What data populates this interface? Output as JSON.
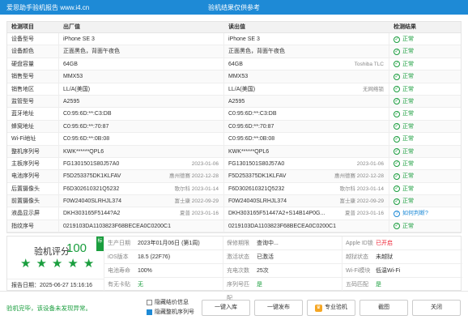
{
  "window": {
    "title": "爱思助手验机报告 www.i4.cn",
    "center_note": "验机结果仅供参考"
  },
  "table": {
    "headers": [
      "检测项目",
      "出厂值",
      "读出值",
      "检测结果"
    ],
    "rows": [
      {
        "item": "设备型号",
        "factory": "iPhone SE 3",
        "factory_aux": "",
        "read": "iPhone SE 3",
        "read_aux": "",
        "result": "正常",
        "result_type": "ok"
      },
      {
        "item": "设备颜色",
        "factory": "正面黑色，背面午夜色",
        "factory_aux": "",
        "read": "正面黑色，背面午夜色",
        "read_aux": "",
        "result": "正常",
        "result_type": "ok"
      },
      {
        "item": "硬盘容量",
        "factory": "64GB",
        "factory_aux": "",
        "read": "64GB",
        "read_aux": "Toshiba TLC",
        "result": "正常",
        "result_type": "ok"
      },
      {
        "item": "销售型号",
        "factory": "MMX53",
        "factory_aux": "",
        "read": "MMX53",
        "read_aux": "",
        "result": "正常",
        "result_type": "ok"
      },
      {
        "item": "销售地区",
        "factory": "LL/A(美国)",
        "factory_aux": "",
        "read": "LL/A(美国)",
        "read_aux": "无网络锁",
        "result": "正常",
        "result_type": "ok"
      },
      {
        "item": "监管型号",
        "factory": "A2595",
        "factory_aux": "",
        "read": "A2595",
        "read_aux": "",
        "result": "正常",
        "result_type": "ok"
      },
      {
        "item": "蓝牙地址",
        "factory": "C0:95:6D:**:C3:DB",
        "factory_aux": "",
        "read": "C0:95:6D:**:C3:DB",
        "read_aux": "",
        "result": "正常",
        "result_type": "ok"
      },
      {
        "item": "蜂窝地址",
        "factory": "C0:95:6D:**:70:87",
        "factory_aux": "",
        "read": "C0:95:6D:**:70:87",
        "read_aux": "",
        "result": "正常",
        "result_type": "ok"
      },
      {
        "item": "Wi-Fi地址",
        "factory": "C0:95:6D:**:0B:08",
        "factory_aux": "",
        "read": "C0:95:6D:**:0B:08",
        "read_aux": "",
        "result": "正常",
        "result_type": "ok"
      },
      {
        "item": "整机序列号",
        "factory": "KWK******QPL6",
        "factory_aux": "",
        "read": "KWK******QPL6",
        "read_aux": "",
        "result": "正常",
        "result_type": "ok"
      },
      {
        "item": "主板序列号",
        "factory": "FG1301501S80J57A0",
        "factory_aux": "2023-01-06",
        "read": "FG1301501S80J57A0",
        "read_aux": "2023-01-06",
        "result": "正常",
        "result_type": "ok"
      },
      {
        "item": "电池序列号",
        "factory": "F5D253375DK1KLFAV",
        "factory_aux": "惠州德赛 2022-12-28",
        "read": "F5D253375DK1KLFAV",
        "read_aux": "惠州德赛 2022-12-28",
        "result": "正常",
        "result_type": "ok"
      },
      {
        "item": "后置摄像头",
        "factory": "F6D302610321Q5232",
        "factory_aux": "歌尔科 2023-01-14",
        "read": "F6D302610321Q5232",
        "read_aux": "歌尔科 2023-01-14",
        "result": "正常",
        "result_type": "ok"
      },
      {
        "item": "前置摄像头",
        "factory": "F0W24040SLRHJL374",
        "factory_aux": "富士康 2022-09-29",
        "read": "F0W24040SLRHJL374",
        "read_aux": "富士康 2022-09-29",
        "result": "正常",
        "result_type": "ok"
      },
      {
        "item": "液晶显示屏",
        "factory": "DKH303165F5144?A2",
        "factory_aux": "夏普 2023-01-16",
        "read": "DKH303165F51447A2+S14B14P0G...",
        "read_aux": "夏普 2023-01-16",
        "result": "如何判断?",
        "result_type": "help"
      },
      {
        "item": "指纹序号",
        "factory": "0219103DA1103823F68BECEA0C0200C1",
        "factory_aux": "",
        "read": "0219103DA1103823F68BECEA0C0200C1",
        "read_aux": "",
        "result": "正常",
        "result_type": "ok"
      }
    ]
  },
  "score": {
    "label": "验机评分",
    "value": "100",
    "badge": "标",
    "stars": 5,
    "report_date_label": "报告日期：",
    "report_date": "2025-06-27 15:16:16"
  },
  "details": [
    [
      {
        "key": "生产日期",
        "value": "2023年01月06日 (第1周)",
        "style": ""
      },
      {
        "key": "保修期限",
        "value": "查询中...",
        "style": ""
      },
      {
        "key": "Apple ID锁",
        "value": "已开启",
        "style": "red"
      }
    ],
    [
      {
        "key": "iOS版本",
        "value": "18.5 (22F76)",
        "style": ""
      },
      {
        "key": "激活状态",
        "value": "已激活",
        "style": ""
      },
      {
        "key": "越狱状态",
        "value": "未越狱",
        "style": ""
      }
    ],
    [
      {
        "key": "电池寿命",
        "value": "100%",
        "style": ""
      },
      {
        "key": "充电次数",
        "value": "25次",
        "style": ""
      },
      {
        "key": "Wi-Fi模块",
        "value": "低温Wi-Fi",
        "style": ""
      }
    ],
    [
      {
        "key": "有无卡贴",
        "value": "无",
        "style": "green"
      },
      {
        "key": "序列号匹配",
        "value": "是",
        "style": "green"
      },
      {
        "key": "五码匹配",
        "value": "是",
        "style": "green"
      }
    ]
  ],
  "footer": {
    "message": "验机完毕，该设备未发现异常。",
    "check_hide_info": "隐藏结价信息",
    "check_hide_serial": "隐藏整机序列号",
    "hide_info_checked": false,
    "hide_serial_checked": true,
    "btn_save": "一键入库",
    "btn_publish": "一键发布",
    "btn_pro": "专业验机",
    "btn_screenshot": "截图",
    "btn_close": "关闭"
  }
}
